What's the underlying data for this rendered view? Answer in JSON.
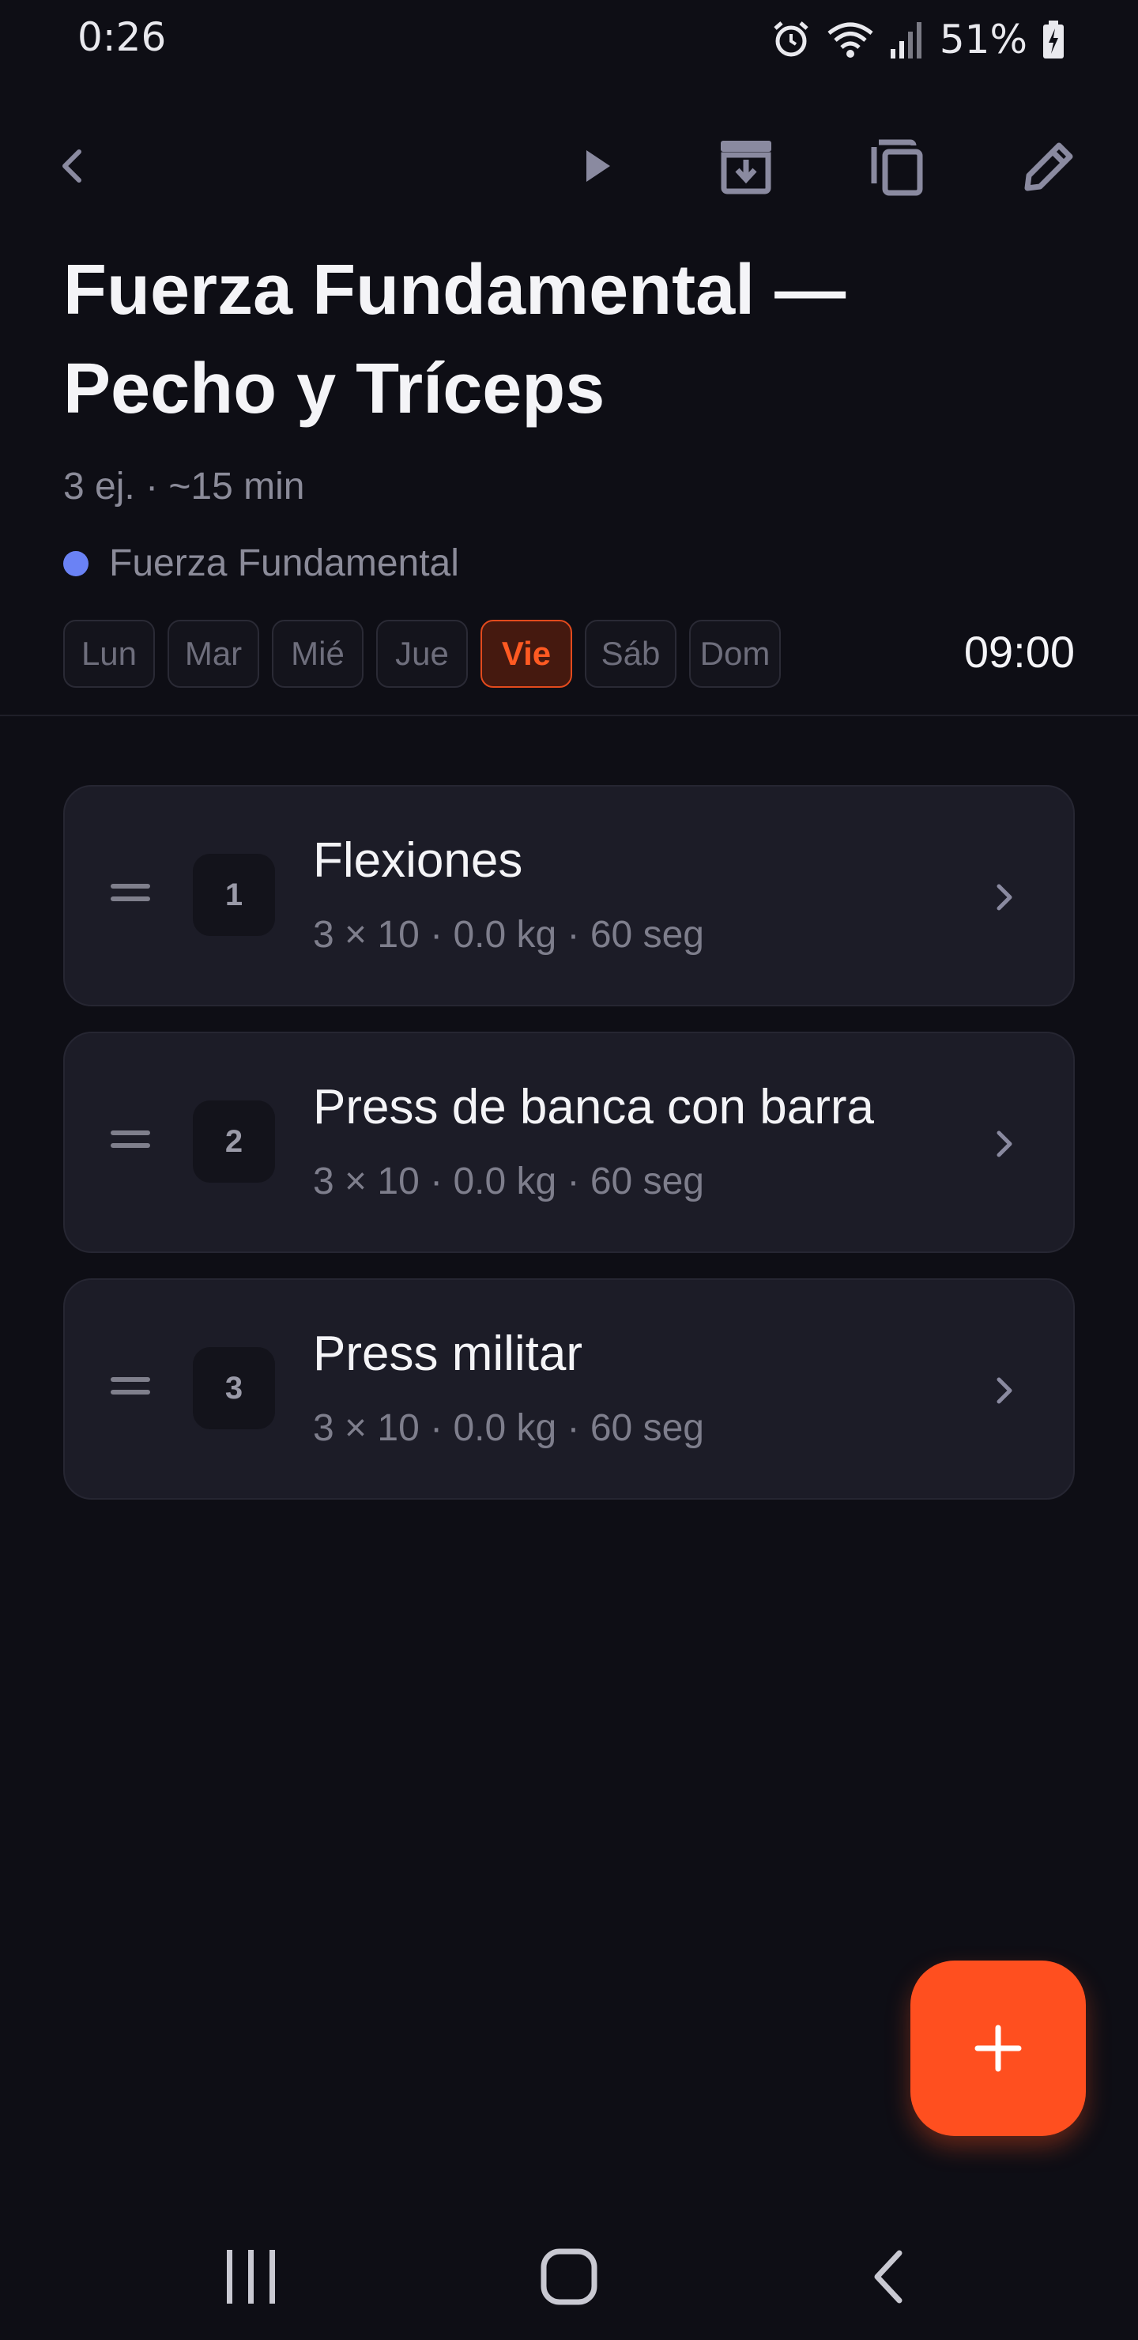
{
  "status": {
    "time": "0:26",
    "battery": "51%",
    "icons": [
      "alarm-icon",
      "wifi-icon",
      "signal-icon",
      "battery-icon"
    ]
  },
  "toolbar": {
    "icons": [
      "back-arrow-icon",
      "play-icon",
      "archive-icon",
      "copy-icon",
      "edit-pencil-icon"
    ]
  },
  "routine": {
    "title": "Fuerza Fundamental — Pecho y Tríceps",
    "meta": "3 ej. · ~15 min",
    "program": "Fuerza Fundamental",
    "program_color": "#6a82f5",
    "days": [
      "Lun",
      "Mar",
      "Mié",
      "Jue",
      "Vie",
      "Sáb",
      "Dom"
    ],
    "active_day": "Vie",
    "time": "09:00"
  },
  "exercises": [
    {
      "index": "1",
      "name": "Flexiones",
      "detail": "3 × 10 · 0.0 kg · 60 seg"
    },
    {
      "index": "2",
      "name": "Press de banca con barra",
      "detail": "3 × 10 · 0.0 kg · 60 seg"
    },
    {
      "index": "3",
      "name": "Press militar",
      "detail": "3 × 10 · 0.0 kg · 60 seg"
    }
  ],
  "fab": {
    "icon": "plus-icon",
    "color": "#ff4f1f"
  },
  "accent": "#ff5a22"
}
